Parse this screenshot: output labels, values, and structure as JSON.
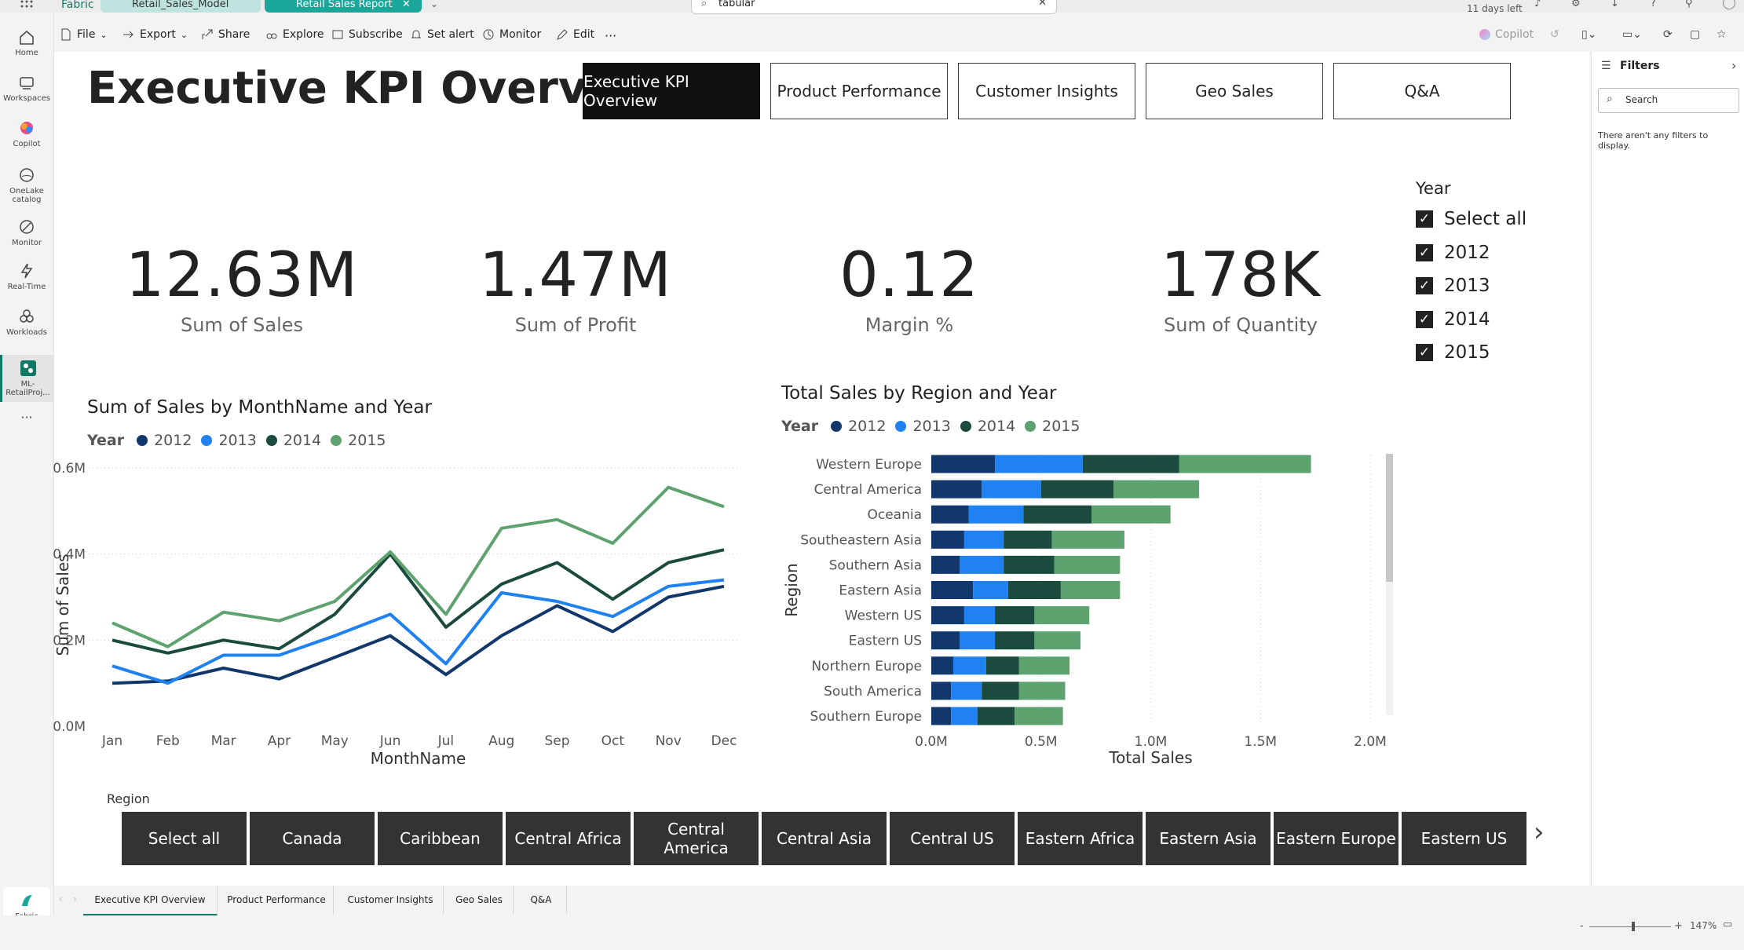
{
  "topbar": {
    "brand": "Fabric",
    "tab_model": "Retail_Sales_Model",
    "tab_report": "Retail Sales Report",
    "search_value": "tabular",
    "trial": "11 days left"
  },
  "toolbar": {
    "file": "File",
    "export": "Export",
    "share": "Share",
    "explore": "Explore",
    "subscribe": "Subscribe",
    "set_alert": "Set alert",
    "monitor": "Monitor",
    "edit": "Edit",
    "more": "···",
    "copilot": "Copilot"
  },
  "rail": [
    {
      "label": "Home",
      "icon": "home-icon"
    },
    {
      "label": "Workspaces",
      "icon": "workspaces-icon"
    },
    {
      "label": "Copilot",
      "icon": "copilot-icon"
    },
    {
      "label": "OneLake catalog",
      "icon": "onelake-icon"
    },
    {
      "label": "Monitor",
      "icon": "monitor-icon"
    },
    {
      "label": "Real-Time",
      "icon": "realtime-icon"
    },
    {
      "label": "Workloads",
      "icon": "workloads-icon"
    },
    {
      "label": "ML-RetailProj...",
      "icon": "project-icon"
    }
  ],
  "rail_more": "···",
  "rail_bottom": "Fabric",
  "report": {
    "title": "Executive KPI Overview",
    "nav": [
      "Executive KPI Overview",
      "Product Performance",
      "Customer Insights",
      "Geo Sales",
      "Q&A"
    ]
  },
  "kpis": [
    {
      "value": "12.63M",
      "label": "Sum of Sales"
    },
    {
      "value": "1.47M",
      "label": "Sum of Profit"
    },
    {
      "value": "0.12",
      "label": "Margin %"
    },
    {
      "value": "178K",
      "label": "Sum of Quantity"
    }
  ],
  "year_slicer": {
    "title": "Year",
    "items": [
      "Select all",
      "2012",
      "2013",
      "2014",
      "2015"
    ]
  },
  "colors": {
    "2012": "#12386b",
    "2013": "#1f82f0",
    "2014": "#1b4a3e",
    "2015": "#5ea36f"
  },
  "chart_data": [
    {
      "type": "line",
      "title": "Sum of Sales by MonthName and Year",
      "legend_title": "Year",
      "xlabel": "MonthName",
      "ylabel": "Sum of Sales",
      "x": [
        "Jan",
        "Feb",
        "Mar",
        "Apr",
        "May",
        "Jun",
        "Jul",
        "Aug",
        "Sep",
        "Oct",
        "Nov",
        "Dec"
      ],
      "yticks": [
        "0.0M",
        "0.2M",
        "0.4M",
        "0.6M"
      ],
      "ylim": [
        0,
        0.6
      ],
      "series": [
        {
          "name": "2012",
          "values": [
            0.1,
            0.105,
            0.135,
            0.11,
            0.16,
            0.21,
            0.12,
            0.21,
            0.28,
            0.22,
            0.3,
            0.325
          ]
        },
        {
          "name": "2013",
          "values": [
            0.14,
            0.1,
            0.165,
            0.165,
            0.21,
            0.26,
            0.145,
            0.31,
            0.29,
            0.255,
            0.325,
            0.34
          ]
        },
        {
          "name": "2014",
          "values": [
            0.2,
            0.17,
            0.2,
            0.18,
            0.26,
            0.4,
            0.23,
            0.33,
            0.38,
            0.295,
            0.38,
            0.41
          ]
        },
        {
          "name": "2015",
          "values": [
            0.24,
            0.185,
            0.265,
            0.245,
            0.29,
            0.405,
            0.26,
            0.46,
            0.48,
            0.425,
            0.555,
            0.51
          ]
        }
      ],
      "grid": true,
      "legend_position": "top-left"
    },
    {
      "type": "bar",
      "orientation": "horizontal-stacked",
      "title": "Total Sales by Region and Year",
      "legend_title": "Year",
      "xlabel": "Total Sales",
      "ylabel": "Region",
      "categories": [
        "Western Europe",
        "Central America",
        "Oceania",
        "Southeastern Asia",
        "Southern Asia",
        "Eastern Asia",
        "Western US",
        "Eastern US",
        "Northern Europe",
        "South America",
        "Southern Europe"
      ],
      "xticks": [
        "0.0M",
        "0.5M",
        "1.0M",
        "1.5M",
        "2.0M"
      ],
      "xlim": [
        0,
        2.0
      ],
      "series": [
        {
          "name": "2012",
          "values": [
            0.29,
            0.23,
            0.17,
            0.15,
            0.13,
            0.19,
            0.15,
            0.13,
            0.1,
            0.09,
            0.09
          ]
        },
        {
          "name": "2013",
          "values": [
            0.4,
            0.27,
            0.25,
            0.18,
            0.2,
            0.16,
            0.14,
            0.16,
            0.15,
            0.14,
            0.12
          ]
        },
        {
          "name": "2014",
          "values": [
            0.44,
            0.33,
            0.31,
            0.22,
            0.23,
            0.24,
            0.18,
            0.18,
            0.15,
            0.17,
            0.17
          ]
        },
        {
          "name": "2015",
          "values": [
            0.6,
            0.39,
            0.36,
            0.33,
            0.3,
            0.27,
            0.25,
            0.21,
            0.23,
            0.21,
            0.22
          ]
        }
      ],
      "grid": true,
      "legend_position": "top-left"
    }
  ],
  "region_slicer": {
    "title": "Region",
    "items": [
      "Select all",
      "Canada",
      "Caribbean",
      "Central Africa",
      "Central America",
      "Central Asia",
      "Central US",
      "Eastern Africa",
      "Eastern Asia",
      "Eastern Europe",
      "Eastern US"
    ]
  },
  "filters_pane": {
    "title": "Filters",
    "search_placeholder": "Search",
    "empty": "There aren't any filters to display."
  },
  "page_tabs": [
    "Executive KPI Overview",
    "Product Performance",
    "Customer Insights",
    "Geo Sales",
    "Q&A"
  ],
  "status": {
    "zoom": "147%"
  }
}
